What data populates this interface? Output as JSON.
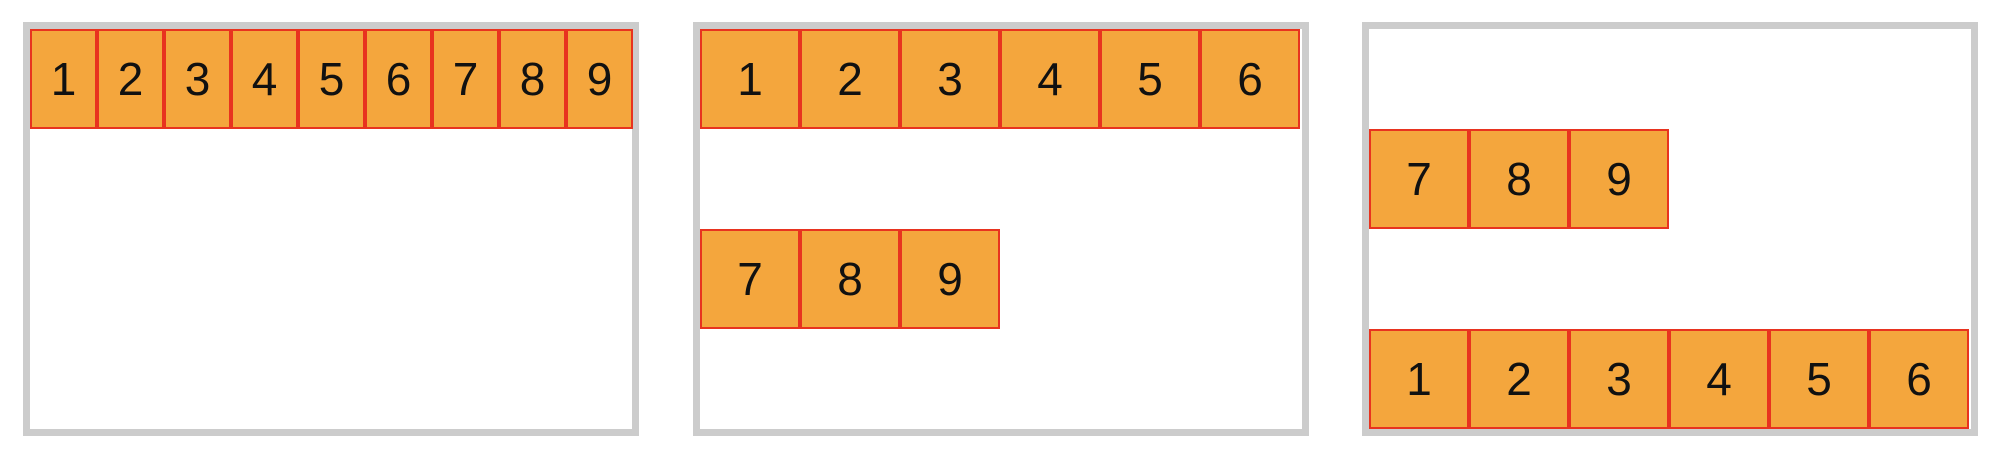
{
  "colors": {
    "item_fill": "#f4a63d",
    "item_border": "#e8331f",
    "container_border": "#cccccc",
    "text": "#111111"
  },
  "panels": [
    {
      "id": "nowrap",
      "rows": [
        [
          "1",
          "2",
          "3",
          "4",
          "5",
          "6",
          "7",
          "8",
          "9"
        ]
      ]
    },
    {
      "id": "wrap",
      "rows": [
        [
          "1",
          "2",
          "3",
          "4",
          "5",
          "6"
        ],
        [
          "7",
          "8",
          "9"
        ]
      ]
    },
    {
      "id": "wrap-reverse",
      "rows": [
        [
          "7",
          "8",
          "9"
        ],
        [
          "1",
          "2",
          "3",
          "4",
          "5",
          "6"
        ]
      ]
    }
  ]
}
